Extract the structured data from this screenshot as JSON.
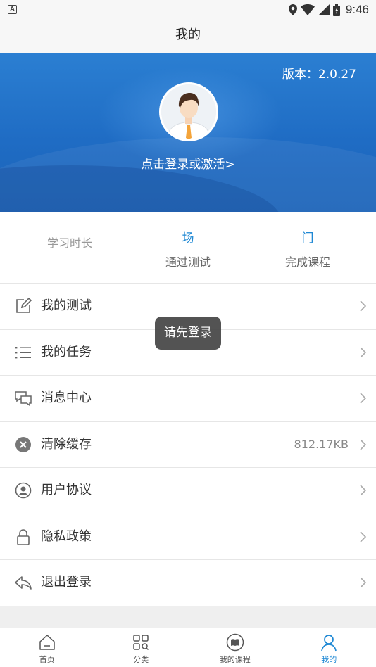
{
  "status_bar": {
    "time": "9:46"
  },
  "header": {
    "title": "我的"
  },
  "profile": {
    "version": "版本：2.0.27",
    "login_link": "点击登录或激活>"
  },
  "stats": [
    {
      "value": "",
      "label": "学习时长"
    },
    {
      "value": "场",
      "label": "通过测试"
    },
    {
      "value": "门",
      "label": "完成课程"
    }
  ],
  "menu": [
    {
      "label": "我的测试",
      "icon": "edit-icon"
    },
    {
      "label": "我的任务",
      "icon": "list-icon"
    },
    {
      "label": "消息中心",
      "icon": "chat-icon"
    },
    {
      "label": "清除缓存",
      "icon": "clear-icon",
      "extra": "812.17KB"
    },
    {
      "label": "用户协议",
      "icon": "user-circle-icon"
    },
    {
      "label": "隐私政策",
      "icon": "lock-icon"
    },
    {
      "label": "退出登录",
      "icon": "reply-icon"
    }
  ],
  "toast": "请先登录",
  "tabbar": {
    "tabs": [
      {
        "label": "首页",
        "icon": "home-icon"
      },
      {
        "label": "分类",
        "icon": "category-icon"
      },
      {
        "label": "我的课程",
        "icon": "book-icon"
      },
      {
        "label": "我的",
        "icon": "person-icon",
        "active": true
      }
    ]
  },
  "colors": {
    "accent": "#1e88d4",
    "banner": "#2474cb"
  }
}
